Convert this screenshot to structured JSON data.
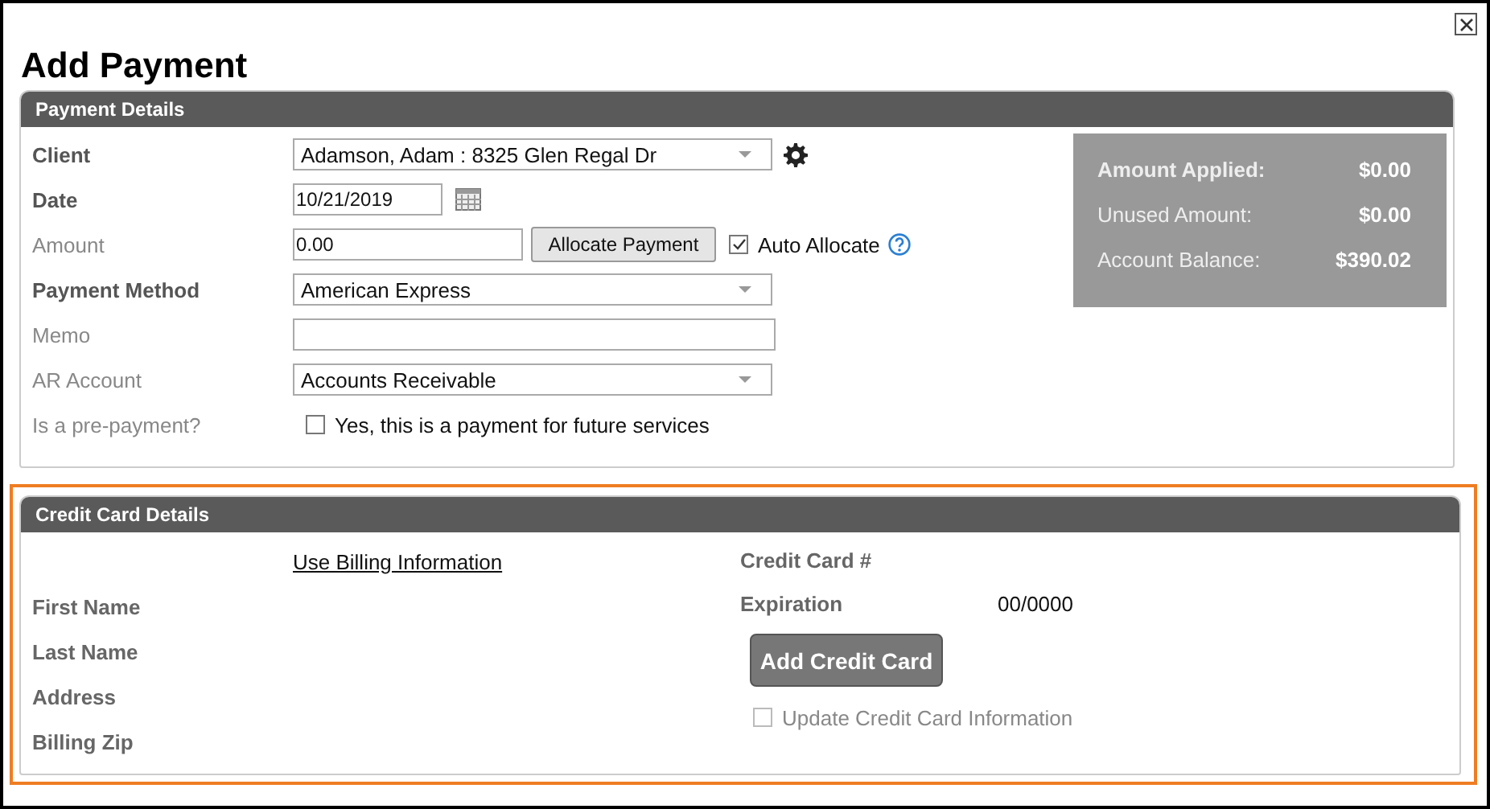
{
  "dialog": {
    "title": "Add Payment"
  },
  "payment_details": {
    "heading": "Payment Details",
    "fields": [
      {
        "kind": "dropdown",
        "label": "Client",
        "required": true,
        "value": "Adamson, Adam : 8325 Glen Regal Dr"
      },
      {
        "kind": "date",
        "label": "Date",
        "required": true,
        "value": "10/21/2019"
      },
      {
        "kind": "amount",
        "label": "Amount",
        "required": false,
        "value": "0.00",
        "button": "Allocate Payment",
        "checkbox_label": "Auto Allocate",
        "checked": true
      },
      {
        "kind": "dropdown",
        "label": "Payment Method",
        "required": true,
        "value": "American Express"
      },
      {
        "kind": "text",
        "label": "Memo",
        "required": false
      },
      {
        "kind": "dropdown",
        "label": "AR Account",
        "required": false,
        "value": "Accounts Receivable"
      },
      {
        "kind": "checkbox",
        "label": "Is a pre-payment?",
        "required": false,
        "checkbox_label": "Yes, this is a payment for future services",
        "checked": false
      }
    ],
    "summary": [
      {
        "label": "Amount Applied:",
        "value": "$0.00",
        "bold": true
      },
      {
        "label": "Unused Amount:",
        "value": "$0.00",
        "bold": false
      },
      {
        "label": "Account Balance:",
        "value": "$390.02",
        "bold": false
      }
    ]
  },
  "credit_card_details": {
    "heading": "Credit Card Details",
    "highlighted": true,
    "link": "Use Billing Information",
    "billing_fields": [
      "First Name",
      "Last Name",
      "Address",
      "Billing Zip"
    ],
    "card_fields": [
      {
        "label": "Credit Card #"
      },
      {
        "label": "Expiration",
        "value": "00/0000"
      }
    ],
    "button": "Add Credit Card",
    "update": {
      "label": "Update Credit Card Information",
      "checked": false,
      "disabled": true
    }
  }
}
